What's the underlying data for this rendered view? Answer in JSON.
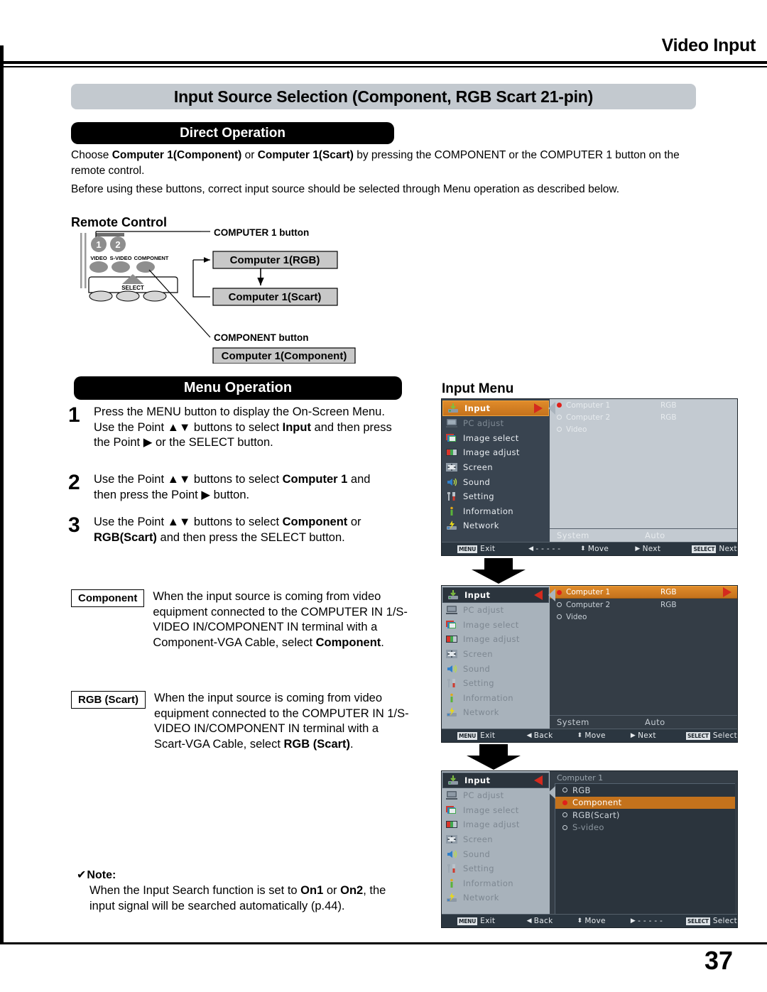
{
  "running_head": "Video Input",
  "title": "Input Source Selection (Component, RGB Scart 21-pin)",
  "page_number": "37",
  "direct_operation": {
    "heading": "Direct Operation",
    "paragraph_1_a": "Choose ",
    "paragraph_1_b": "Computer 1(Component)",
    "paragraph_1_c": " or ",
    "paragraph_1_d": "Computer 1(Scart)",
    "paragraph_1_e": " by pressing the COMPONENT or the COMPUTER 1 button on the remote control.",
    "paragraph_2": "Before using these buttons, correct input source should be selected through Menu operation as described below."
  },
  "remote": {
    "section_label": "Remote Control",
    "callout_computer1": "COMPUTER 1 button",
    "callout_component": "COMPONENT button",
    "box_rgb": "Computer 1(RGB)",
    "box_scart": "Computer 1(Scart)",
    "box_component": "Computer 1(Component)",
    "button_video": "VIDEO",
    "button_svideo": "S-VIDEO",
    "button_component": "COMPONENT",
    "button_select": "SELECT",
    "button_1": "1",
    "button_2": "2"
  },
  "menu_operation": {
    "heading": "Menu Operation",
    "steps": [
      {
        "number": "1",
        "t1": "Press the MENU button to display the On-Screen Menu. Use the Point ",
        "t2": "▲▼",
        "t3": " buttons to select ",
        "bold": "Input",
        "t4": " and then press the Point ",
        "t5": "▶",
        "t6": " or the SELECT button."
      },
      {
        "number": "2",
        "t1": "Use the Point ",
        "t2": "▲▼",
        "t3": " buttons to select ",
        "bold": "Computer 1",
        "t4": " and then press the Point ",
        "t5": "▶",
        "t6": " button."
      },
      {
        "number": "3",
        "t1": "Use the Point ",
        "t2": "▲▼",
        "t3": " buttons to select ",
        "bold": "Component",
        "t4": " or ",
        "bold2": "RGB(Scart)",
        "t6": " and then press the SELECT button."
      }
    ]
  },
  "definitions": [
    {
      "tag": "Component",
      "text_a": "When the input source is coming from video equipment connected to the COMPUTER IN 1/S-VIDEO IN/COMPONENT IN terminal with a Component-VGA Cable, select ",
      "text_bold": "Component",
      "text_b": "."
    },
    {
      "tag": "RGB (Scart)",
      "text_a": "When the input source is coming from video equipment connected to the COMPUTER IN 1/S-VIDEO IN/COMPONENT IN terminal with a Scart-VGA Cable, select ",
      "text_bold": "RGB (Scart)",
      "text_b": "."
    }
  ],
  "note": {
    "check": "✔",
    "title": "Note:",
    "body_a": "When the Input Search function is set to ",
    "body_bold1": "On1",
    "body_b": " or ",
    "body_bold2": "On2",
    "body_c": ", the input signal will be searched automatically (p.44)."
  },
  "input_menu_caption": "Input Menu",
  "osd": {
    "sidebar_items": [
      {
        "label": "Input",
        "icon": "input-icon"
      },
      {
        "label": "PC adjust",
        "icon": "pc-adjust-icon"
      },
      {
        "label": "Image select",
        "icon": "image-select-icon"
      },
      {
        "label": "Image adjust",
        "icon": "image-adjust-icon"
      },
      {
        "label": "Screen",
        "icon": "screen-icon"
      },
      {
        "label": "Sound",
        "icon": "sound-icon"
      },
      {
        "label": "Setting",
        "icon": "setting-icon"
      },
      {
        "label": "Information",
        "icon": "information-icon"
      },
      {
        "label": "Network",
        "icon": "network-icon"
      }
    ],
    "sources": [
      {
        "name": "Computer 1",
        "value": "RGB",
        "selected": true
      },
      {
        "name": "Computer 2",
        "value": "RGB",
        "selected": false
      },
      {
        "name": "Video",
        "value": "",
        "selected": false
      }
    ],
    "system_key": "System",
    "system_value": "Auto",
    "submenu_title": "Computer 1",
    "submenu_items": [
      {
        "label": "RGB",
        "selected": false
      },
      {
        "label": "Component",
        "selected": true
      },
      {
        "label": "RGB(Scart)",
        "selected": false
      },
      {
        "label": "S-video",
        "selected": false
      }
    ],
    "bar1": {
      "menu_key": "MENU",
      "exit": "Exit",
      "back": "- - - - -",
      "move": "Move",
      "next": "Next",
      "select_key": "SELECT",
      "select": "Next"
    },
    "bar2": {
      "menu_key": "MENU",
      "exit": "Exit",
      "back": "Back",
      "move": "Move",
      "next": "Next",
      "select_key": "SELECT",
      "select": "Select"
    },
    "bar3": {
      "menu_key": "MENU",
      "exit": "Exit",
      "back": "Back",
      "move": "Move",
      "next": "- - - - -",
      "select_key": "SELECT",
      "select": "Select"
    }
  },
  "colors": {
    "accent_orange": "#c4721c",
    "osd_dark": "#2e3740",
    "osd_dim": "#a8b2bb",
    "red": "#d42a1e",
    "title_band": "#c3c9cf"
  }
}
